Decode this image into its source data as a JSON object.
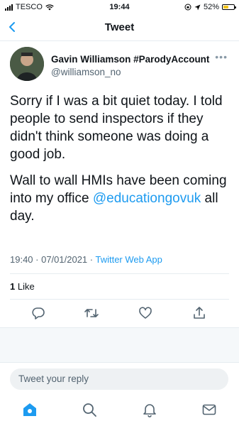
{
  "status_bar": {
    "carrier": "TESCO",
    "time": "19:44",
    "battery": "52%",
    "battery_level": 0.52
  },
  "nav": {
    "title": "Tweet"
  },
  "tweet": {
    "display_name": "Gavin Williamson #ParodyAccount",
    "handle": "@williamson_no",
    "paragraph1": "Sorry if I was a bit quiet today. I told people to send inspectors if they didn't think someone was doing a good job.",
    "paragraph2_before": "Wall to wall HMIs have been coming into my office ",
    "paragraph2_mention": "@educationgovuk",
    "paragraph2_after": " all day.",
    "timestamp": "19:40 · 07/01/2021 · ",
    "source": "Twitter Web App",
    "likes_count": "1",
    "likes_label": " Like"
  },
  "reply": {
    "placeholder": "Tweet your reply"
  },
  "icons": {
    "back": "chevron-left-icon",
    "more": "more-icon",
    "reply": "reply-icon",
    "retweet": "retweet-icon",
    "like": "heart-icon",
    "share": "share-icon",
    "home": "home-icon",
    "search": "search-icon",
    "notifications": "bell-icon",
    "messages": "mail-icon"
  },
  "colors": {
    "accent": "#1d9bf0",
    "secondary_text": "#536471",
    "battery": "#f5c518"
  }
}
